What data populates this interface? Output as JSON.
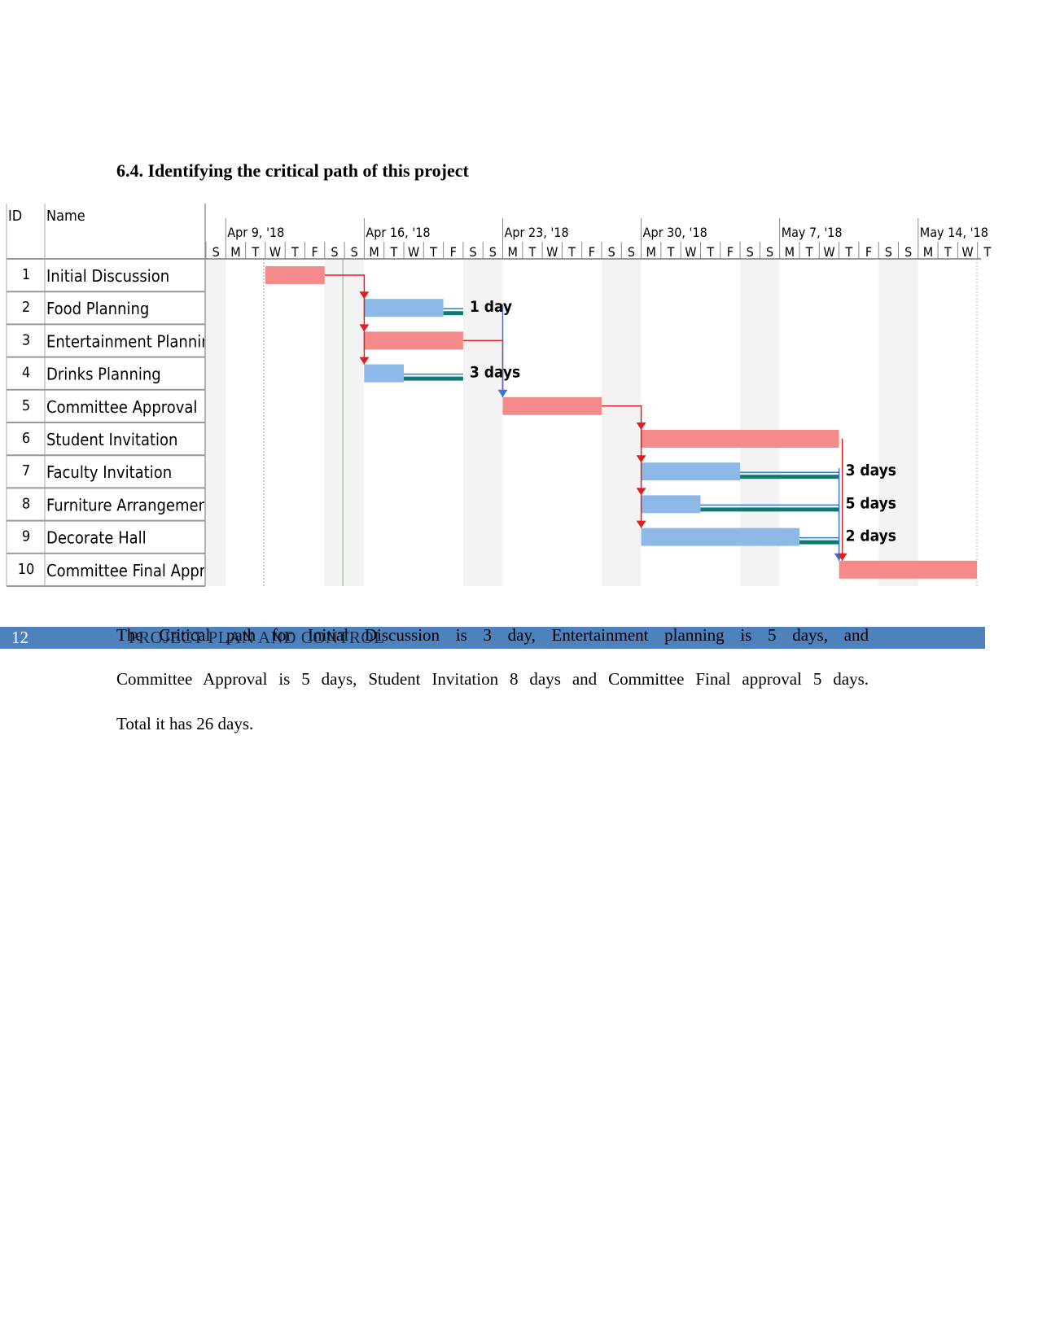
{
  "heading": "6.4. Identifying the critical path of this project",
  "gantt": {
    "columns": {
      "id": "ID",
      "name": "Name"
    },
    "timeline_start": "2018-04-08",
    "weeks": [
      "Apr 9, '18",
      "Apr 16, '18",
      "Apr 23, '18",
      "Apr 30, '18",
      "May 7, '18",
      "May 14, '18"
    ],
    "day_letters": [
      "S",
      "M",
      "T",
      "W",
      "T",
      "F",
      "S"
    ],
    "colors": {
      "critical": "#f48a8a",
      "noncritical": "#8db9e8",
      "slack": "#0e7a73",
      "critical_link": "#e02020",
      "link": "#2f7ad6",
      "status_line": "#6fbf6f"
    },
    "tasks": [
      {
        "id": "1",
        "name": "Initial Discussion",
        "start": "2018-04-11",
        "finish": "2018-04-13",
        "critical": true
      },
      {
        "id": "2",
        "name": "Food Planning",
        "start": "2018-04-16",
        "finish": "2018-04-19",
        "critical": false,
        "slack_to": "2018-04-20",
        "slack_label": "1 day"
      },
      {
        "id": "3",
        "name": "Entertainment Planning",
        "start": "2018-04-16",
        "finish": "2018-04-20",
        "critical": true
      },
      {
        "id": "4",
        "name": "Drinks Planning",
        "start": "2018-04-16",
        "finish": "2018-04-17",
        "critical": false,
        "slack_to": "2018-04-20",
        "slack_label": "3 days"
      },
      {
        "id": "5",
        "name": "Committee Approval",
        "start": "2018-04-23",
        "finish": "2018-04-27",
        "critical": true
      },
      {
        "id": "6",
        "name": "Student Invitation",
        "start": "2018-04-30",
        "finish": "2018-05-09",
        "critical": true
      },
      {
        "id": "7",
        "name": "Faculty Invitation",
        "start": "2018-04-30",
        "finish": "2018-05-04",
        "critical": false,
        "slack_to": "2018-05-09",
        "slack_label": "3 days"
      },
      {
        "id": "8",
        "name": "Furniture Arrangement",
        "start": "2018-04-30",
        "finish": "2018-05-02",
        "critical": false,
        "slack_to": "2018-05-09",
        "slack_label": "5 days"
      },
      {
        "id": "9",
        "name": "Decorate Hall",
        "start": "2018-04-30",
        "finish": "2018-05-07",
        "critical": false,
        "slack_to": "2018-05-09",
        "slack_label": "2 days"
      },
      {
        "id": "10",
        "name": "Committee Final Approval",
        "start": "2018-05-10",
        "finish": "2018-05-16",
        "critical": true
      }
    ]
  },
  "footer": {
    "page_number": "12",
    "running_head": "PROJECT PLAN AND CONTROL"
  },
  "body": {
    "p1": "The Critical path for Initial Discussion is 3 day, Entertainment planning is 5 days, and",
    "p2": "Committee Approval is 5 days, Student Invitation 8 days and Committee Final approval 5 days.",
    "p3": "Total it has 26 days."
  }
}
